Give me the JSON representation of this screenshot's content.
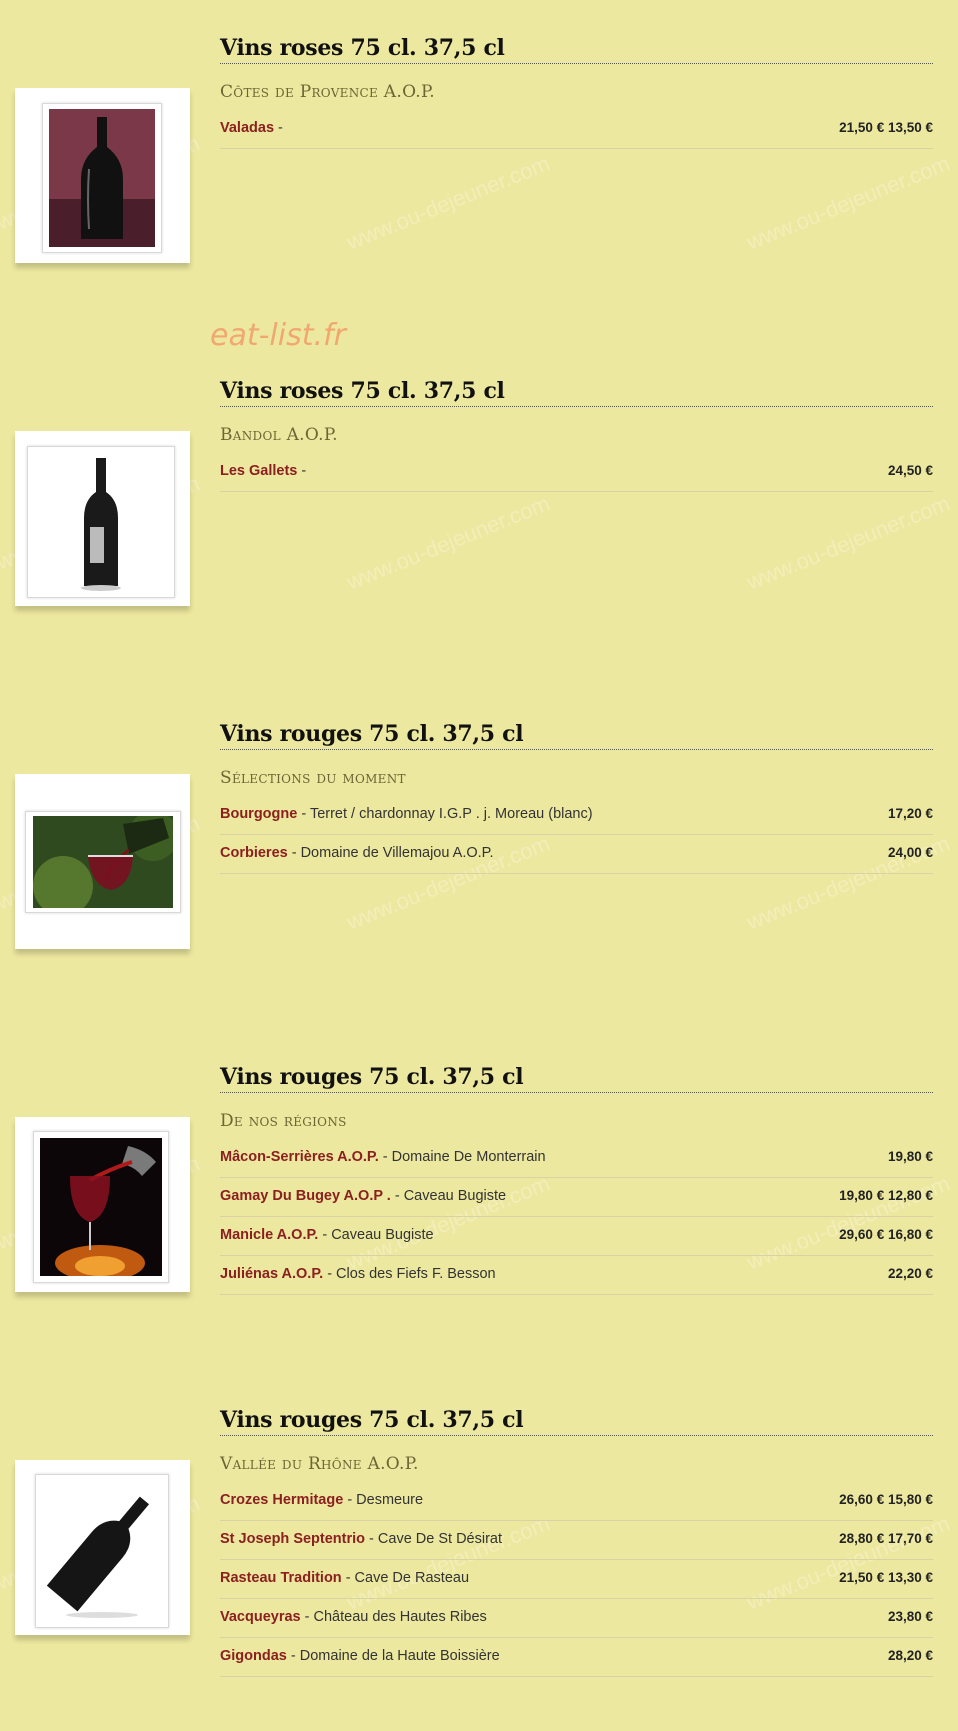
{
  "watermark": "www.ou-dejeuner.com",
  "brand": "eat-list.fr",
  "sections": [
    {
      "title": "Vins roses 75 cl. 37,5 cl",
      "subtitle": "Côtes de Provence A.O.P.",
      "image_icon": "wine-bottle-icon",
      "items": [
        {
          "name": "Valadas",
          "desc": " - ",
          "price": "21,50 € 13,50 €"
        }
      ]
    },
    {
      "title": "Vins roses 75 cl. 37,5 cl",
      "subtitle": "Bandol A.O.P.",
      "image_icon": "wine-bottle-icon",
      "items": [
        {
          "name": "Les Gallets",
          "desc": " - ",
          "price": "24,50 €"
        }
      ]
    },
    {
      "title": "Vins rouges 75 cl. 37,5 cl",
      "subtitle": "Sélections du moment",
      "image_icon": "wine-pour-icon",
      "items": [
        {
          "name": "Bourgogne",
          "desc": " - Terret / chardonnay I.G.P . j. Moreau (blanc)",
          "price": "17,20 €"
        },
        {
          "name": "Corbieres",
          "desc": " - Domaine de Villemajou A.O.P.",
          "price": "24,00 €"
        }
      ]
    },
    {
      "title": "Vins rouges 75 cl. 37,5 cl",
      "subtitle": "De nos régions",
      "image_icon": "wine-glass-icon",
      "items": [
        {
          "name": "Mâcon-Serrières A.O.P.",
          "desc": " - Domaine De Monterrain",
          "price": "19,80 €"
        },
        {
          "name": "Gamay Du Bugey A.O.P .",
          "desc": " - Caveau Bugiste",
          "price": "19,80 € 12,80 €"
        },
        {
          "name": "Manicle A.O.P.",
          "desc": " - Caveau Bugiste",
          "price": "29,60 € 16,80 €"
        },
        {
          "name": "Juliénas A.O.P.",
          "desc": " - Clos des Fiefs F. Besson",
          "price": "22,20 €"
        }
      ]
    },
    {
      "title": "Vins rouges 75 cl. 37,5 cl",
      "subtitle": "Vallée du Rhône A.O.P.",
      "image_icon": "wine-bottle-icon",
      "items": [
        {
          "name": "Crozes Hermitage",
          "desc": " - Desmeure",
          "price": "26,60 € 15,80 €"
        },
        {
          "name": "St Joseph Septentrio",
          "desc": " - Cave De St Désirat",
          "price": "28,80 € 17,70 €"
        },
        {
          "name": "Rasteau Tradition",
          "desc": " - Cave De Rasteau",
          "price": "21,50 € 13,30 €"
        },
        {
          "name": "Vacqueyras",
          "desc": " - Château des Hautes Ribes",
          "price": "23,80 €"
        },
        {
          "name": "Gigondas",
          "desc": " - Domaine de la Haute Boissière",
          "price": "28,20 €"
        }
      ]
    }
  ]
}
